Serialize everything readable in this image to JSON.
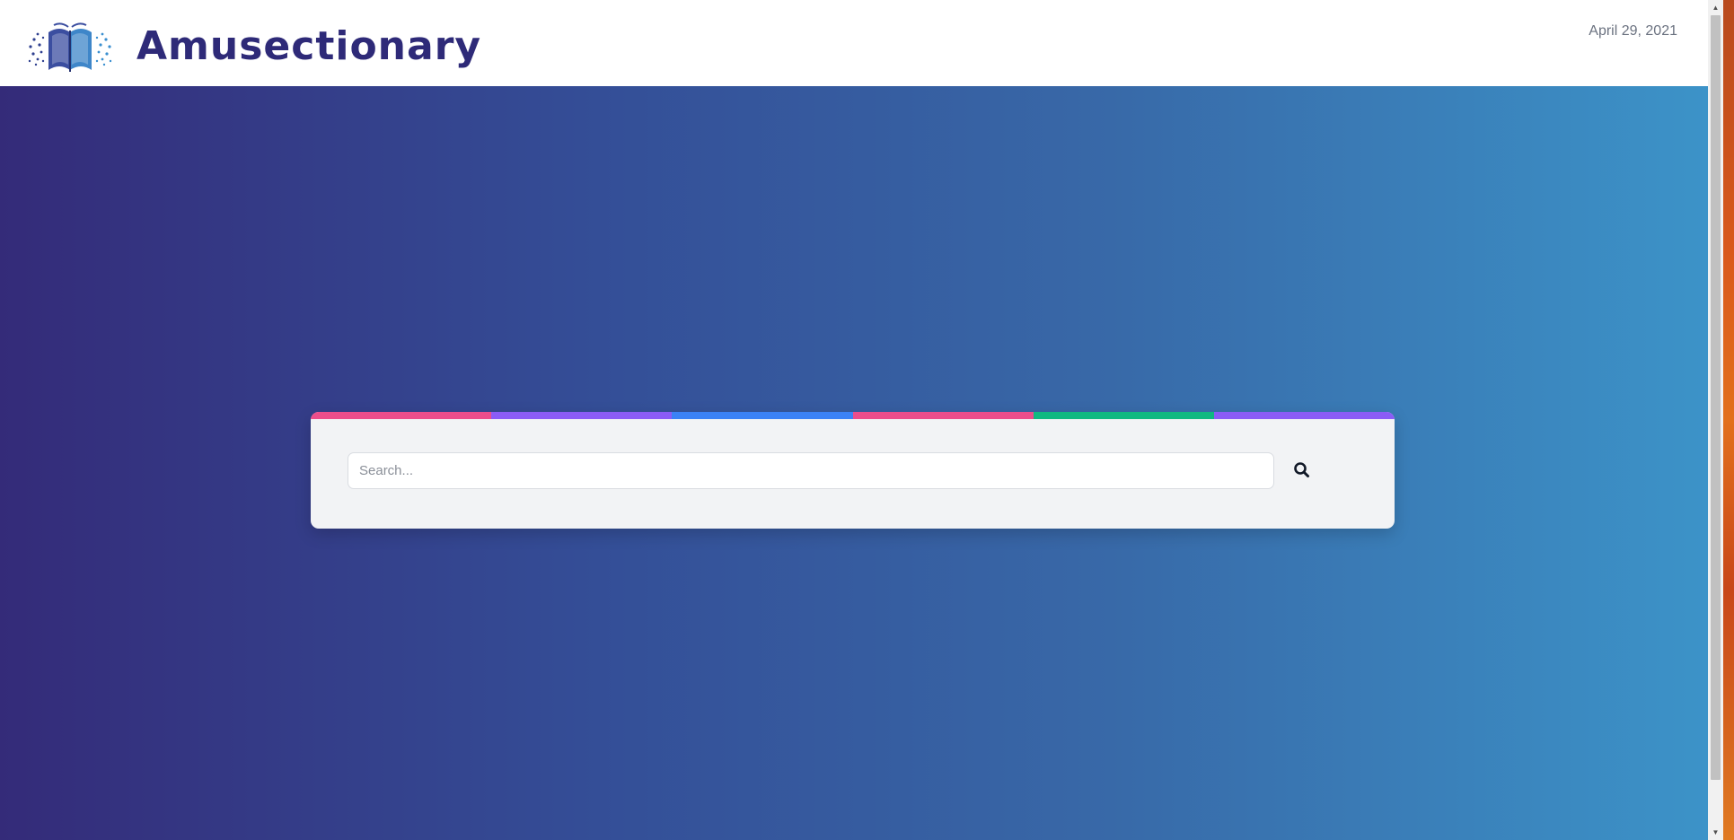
{
  "app": {
    "brand_name": "Amusectionary",
    "date": "April 29, 2021",
    "logo_icon": "open-book-icon"
  },
  "search": {
    "placeholder": "Search...",
    "value": "",
    "button_icon": "search-icon"
  },
  "colors": {
    "brand": "#2e2a78",
    "hero_gradient": [
      "#342b79",
      "#344e97",
      "#3869a8",
      "#3c93c8"
    ],
    "card_background": "#f2f3f5",
    "stripe": [
      "#ec4d8b",
      "#8b5cf6",
      "#3b82f6",
      "#ec4d8b",
      "#10b981",
      "#8b5cf6"
    ]
  }
}
